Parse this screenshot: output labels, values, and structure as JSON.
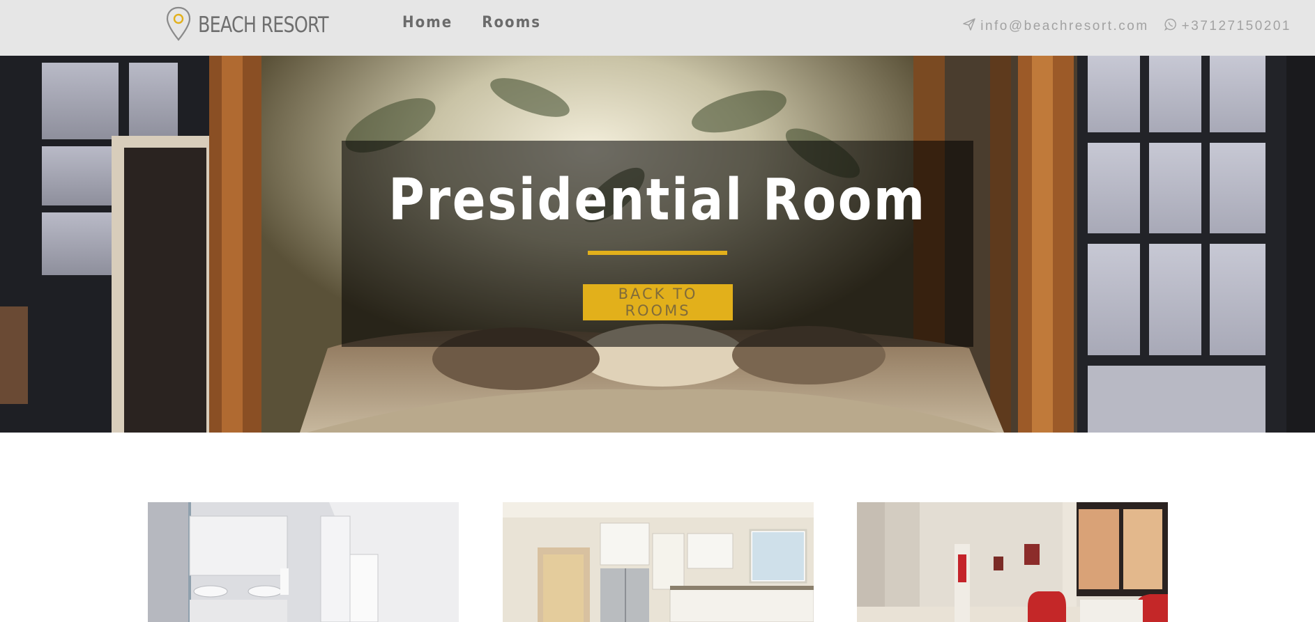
{
  "brand": {
    "name": "BEACH RESORT",
    "accent": "#e2b01b"
  },
  "nav": {
    "items": [
      {
        "label": "Home"
      },
      {
        "label": "Rooms"
      }
    ]
  },
  "contact": {
    "email": "info@beachresort.com",
    "phone": "+37127150201"
  },
  "icons": {
    "logo": "map-pin-icon",
    "email": "paper-plane-icon",
    "phone": "whatsapp-icon"
  },
  "hero": {
    "title": "Presidential Room",
    "button_label": "BACK TO ROOMS"
  },
  "gallery": {
    "images": [
      {
        "subject": "bathroom"
      },
      {
        "subject": "kitchen"
      },
      {
        "subject": "living-room"
      }
    ]
  }
}
